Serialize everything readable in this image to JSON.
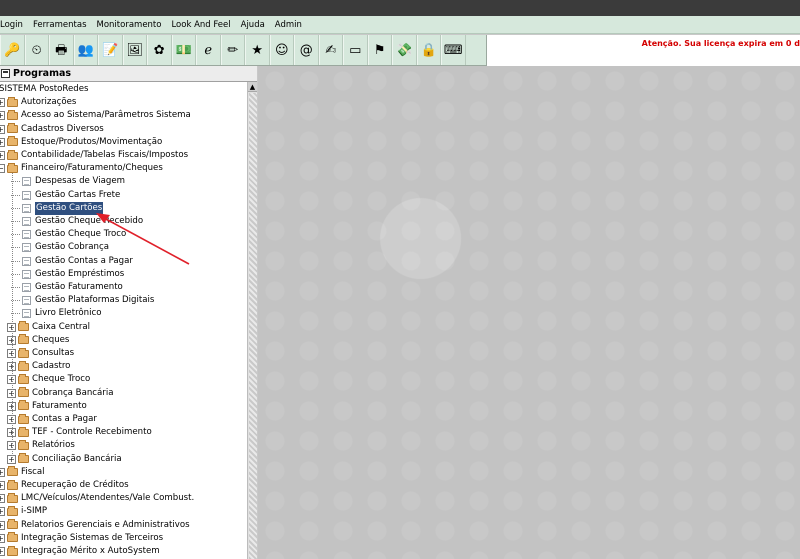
{
  "menu": {
    "items": [
      {
        "label": "Login"
      },
      {
        "label": "Ferramentas"
      },
      {
        "label": "Monitoramento"
      },
      {
        "label": "Look And Feel"
      },
      {
        "label": "Ajuda"
      },
      {
        "label": "Admin"
      }
    ]
  },
  "toolbar": {
    "icons": [
      "key-icon",
      "clock-icon",
      "printer-icon",
      "users-icon",
      "notepad-icon",
      "picture-icon",
      "flower-icon",
      "money-icon",
      "internet-explorer-icon",
      "pencil-icon",
      "star-icon",
      "face-icon",
      "email-icon",
      "hand-icon",
      "card-icon",
      "flag-icon",
      "cash-icon",
      "lock-icon",
      "keyboard-icon"
    ],
    "glyphs": [
      "🔑",
      "⏲",
      "🖶",
      "👥",
      "📝",
      "🖼",
      "✿",
      "💵",
      "ℯ",
      "✏",
      "★",
      "☺",
      "@",
      "✍",
      "▭",
      "⚑",
      "💸",
      "🔒",
      "⌨"
    ],
    "notice": "Atenção. Sua licença expira em 0 d"
  },
  "panel": {
    "title": "Programas"
  },
  "tree": {
    "root": "SISTEMA PostoRedes",
    "top_before": [
      "Autorizações",
      "Acesso ao Sistema/Parâmetros Sistema",
      "Cadastros Diversos",
      "Estoque/Produtos/Movimentação",
      "Contabilidade/Tabelas Fiscais/Impostos"
    ],
    "open_folder": "Financeiro/Faturamento/Cheques",
    "open_expander": "−",
    "leaves": [
      "Despesas de Viagem",
      "Gestão Cartas Frete",
      "Gestão Cartões",
      "Gestão Cheque Recebido",
      "Gestão Cheque Troco",
      "Gestão Cobrança",
      "Gestão Contas a Pagar",
      "Gestão Empréstimos",
      "Gestão Faturamento",
      "Gestão Plataformas Digitais",
      "Livro Eletrônico"
    ],
    "selected_leaf": "Gestão Cartões",
    "subfolders": [
      "Caixa Central",
      "Cheques",
      "Consultas",
      "Cadastro",
      "Cheque Troco",
      "Cobrança Bancária",
      "Faturamento",
      "Contas a Pagar",
      "TEF - Controle Recebimento",
      "Relatórios",
      "Conciliação Bancária"
    ],
    "top_after": [
      "Fiscal",
      "Recuperação de Créditos",
      "LMC/Veículos/Atendentes/Vale Combust.",
      "i-SIMP",
      "Relatorios Gerenciais e Administrativos",
      "Integração Sistemas de Terceiros",
      "Integração Mérito x AutoSystem"
    ],
    "expander_symbol": "+"
  },
  "annotation": {
    "color": "#e0202a"
  }
}
